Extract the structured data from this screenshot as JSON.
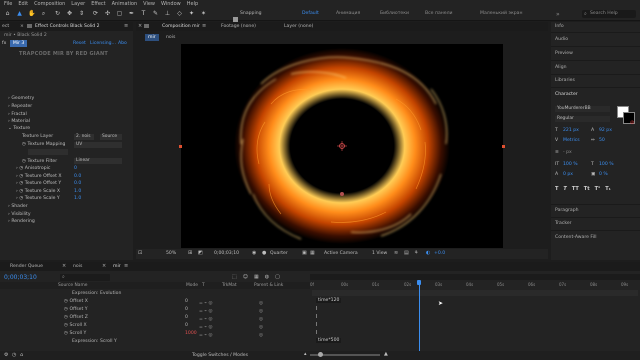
{
  "menu": [
    "File",
    "Edit",
    "Composition",
    "Layer",
    "Effect",
    "Animation",
    "View",
    "Window",
    "Help"
  ],
  "toolbar": {
    "snapping_label": "Snapping",
    "workspaces": [
      "Default",
      "Анимация",
      "Библиотеки",
      "Все панели",
      "Маленький экран"
    ],
    "active_workspace": "Default",
    "search_placeholder": "Search Help"
  },
  "effect_controls": {
    "tab_project": "ect",
    "tab_label": "Effect Controls Black Solid 2",
    "breadcrumb": "mir • Black Solid 2",
    "effect_name": "Mir 3",
    "reset": "Reset",
    "licensing": "Licensing...",
    "about": "Abo",
    "brand": "TRAPCODE MIR BY RED GIANT",
    "groups": [
      "Geometry",
      "Repeater",
      "Fractal",
      "Material",
      "Texture"
    ],
    "texture_layer_label": "Texture Layer",
    "texture_layer_value": "2. nois",
    "texture_layer_source": "Source",
    "texture_mapping_label": "Texture Mapping",
    "texture_mapping_value": "UV",
    "texture_filter_label": "Texture Filter",
    "texture_filter_value": "Linear",
    "params": [
      {
        "label": "Anisotropic",
        "value": "0"
      },
      {
        "label": "Texture Offset X",
        "value": "0.0"
      },
      {
        "label": "Texture Offset Y",
        "value": "0.0"
      },
      {
        "label": "Texture Scale X",
        "value": "1.0"
      },
      {
        "label": "Texture Scale Y",
        "value": "1.0"
      }
    ],
    "more_groups": [
      "Shader",
      "Visibility",
      "Rendering"
    ]
  },
  "viewer": {
    "tab_label": "Composition mir",
    "tab_name": "mir",
    "sub_tab": "nois",
    "footage_tab": "Footage (none)",
    "layer_tab": "Layer (none)",
    "zoom": "50%",
    "timecode": "0;00;03;10",
    "resolution": "Quarter",
    "camera": "Active Camera",
    "views": "1 View",
    "exposure": "+0.0"
  },
  "right_panels": {
    "items_top": [
      "Info",
      "Audio",
      "Preview",
      "Align",
      "Libraries"
    ],
    "character_title": "Character",
    "font_name": "YouMurdererBB",
    "font_style": "Regular",
    "font_size": "221 px",
    "leading": "92 px",
    "tracking_metrics": "Metrics",
    "tracking_value": "50",
    "stroke_px": "- px",
    "scale_v": "100 %",
    "scale_h": "100 %",
    "baseline": "0 px",
    "tsume": "0 %",
    "style_buttons": [
      "T",
      "T",
      "TT",
      "Tt",
      "T¹",
      "T₁"
    ],
    "items_bottom": [
      "Paragraph",
      "Tracker",
      "Content-Aware Fill"
    ]
  },
  "timeline": {
    "tabs": [
      "Render Queue",
      "nois",
      "mir"
    ],
    "active_tab": "mir",
    "timecode": "0;00;03;10",
    "columns": {
      "source": "Source Name",
      "mode": "Mode",
      "t": "T",
      "trkmat": "TrkMat",
      "parent": "Parent & Link"
    },
    "rows": [
      {
        "label": "Expression: Evolution",
        "value": ""
      },
      {
        "label": "Offset X",
        "value": "0"
      },
      {
        "label": "Offset Y",
        "value": "0"
      },
      {
        "label": "Offset Z",
        "value": "0"
      },
      {
        "label": "Scroll X",
        "value": "0"
      },
      {
        "label": "Scroll Y",
        "value": "1000"
      },
      {
        "label": "Expression: Scroll Y",
        "value": ""
      }
    ],
    "expression_evolution": "time*120",
    "expression_scroll": "time*500",
    "ruler": [
      "0f",
      "00s",
      "01s",
      "02s",
      "03s",
      "04s",
      "05s",
      "06s",
      "07s",
      "08s",
      "09s",
      "10s"
    ],
    "playhead_time": "03s",
    "toggle_label": "Toggle Switches / Modes"
  },
  "colors": {
    "accent": "#3b8ef0",
    "panel": "#232323",
    "background": "#1d1d1d",
    "fire": "#ff8c1a"
  }
}
